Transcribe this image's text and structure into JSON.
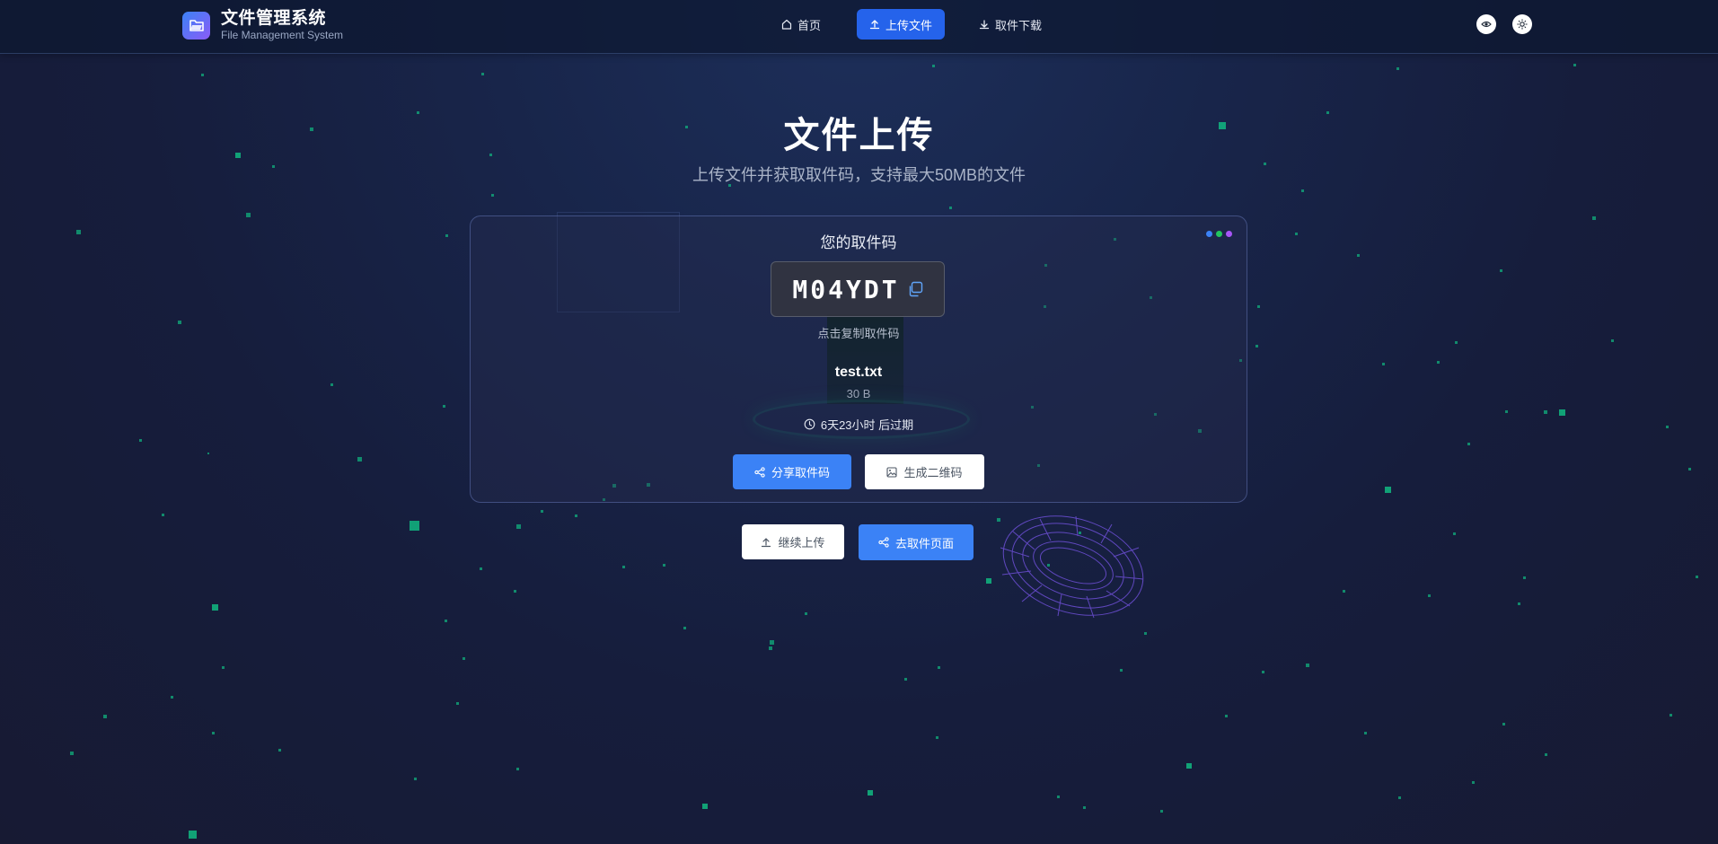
{
  "app": {
    "title": "文件管理系统",
    "subtitle": "File Management System"
  },
  "nav": {
    "items": [
      {
        "label": "首页",
        "icon": "home-icon",
        "active": false
      },
      {
        "label": "上传文件",
        "icon": "upload-icon",
        "active": true
      },
      {
        "label": "取件下载",
        "icon": "download-icon",
        "active": false
      }
    ]
  },
  "header_actions": [
    {
      "icon": "eye-icon"
    },
    {
      "icon": "sun-icon"
    }
  ],
  "hero": {
    "title": "文件上传",
    "subtitle": "上传文件并获取取件码，支持最大50MB的文件"
  },
  "result": {
    "label": "您的取件码",
    "code": "M04YDT",
    "copy_hint": "点击复制取件码",
    "file_name": "test.txt",
    "file_size": "30 B",
    "expire_text": "6天23小时 后过期",
    "share_button": "分享取件码",
    "qr_button": "生成二维码"
  },
  "actions": {
    "continue_upload": "继续上传",
    "go_pickup": "去取件页面"
  },
  "colors": {
    "primary": "#3b82f6",
    "nav_active": "#2563eb",
    "particle": "#10b981",
    "dot_blue": "#3b82f6",
    "dot_green": "#22c55e",
    "dot_purple": "#a855f7"
  }
}
